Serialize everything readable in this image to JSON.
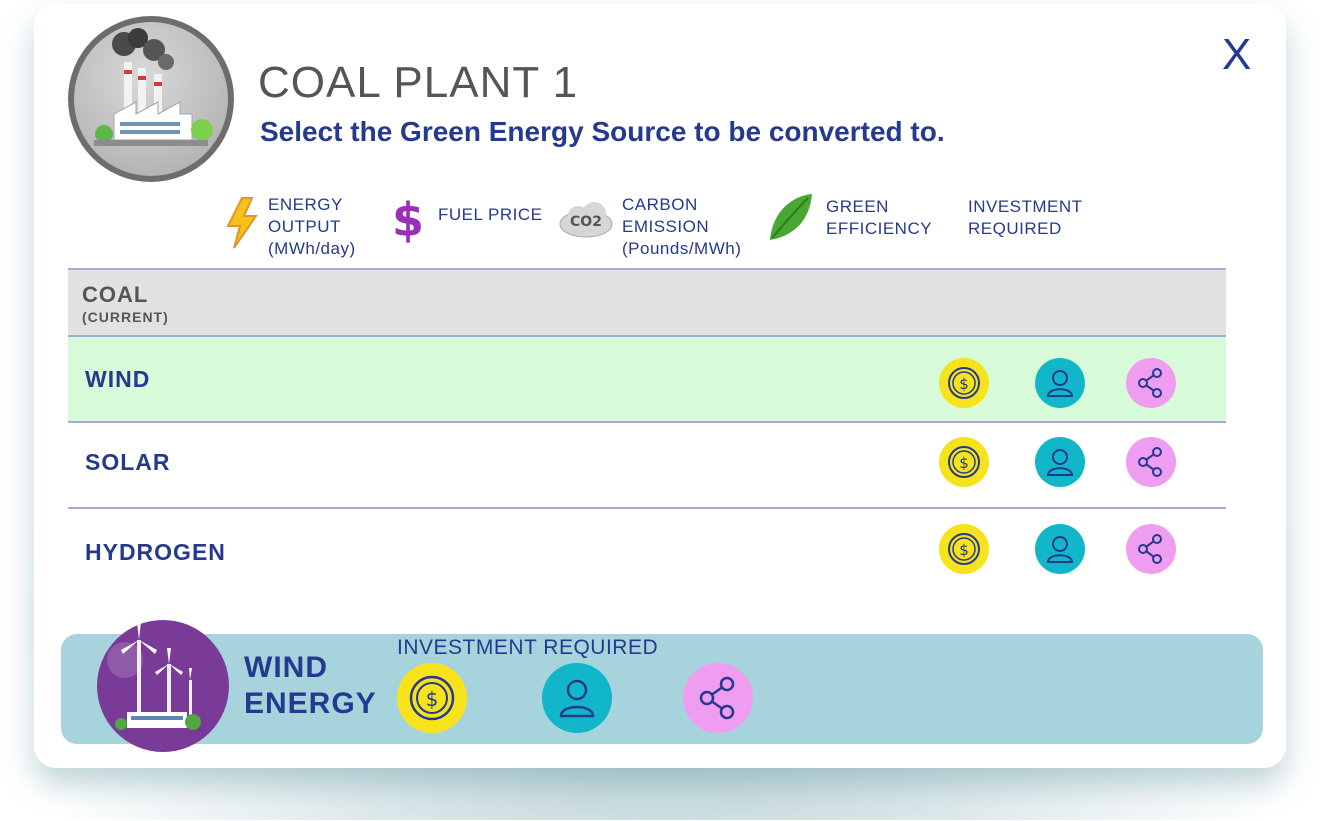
{
  "header": {
    "title": "COAL PLANT 1",
    "subtitle": "Select the Green Energy Source to be converted to.",
    "close_label": "X"
  },
  "legend": {
    "energy_output": {
      "line1": "ENERGY",
      "line2": "OUTPUT",
      "line3": "(MWh/day)",
      "icon": "lightning-icon"
    },
    "fuel_price": {
      "label": "FUEL PRICE",
      "icon": "dollar-icon"
    },
    "carbon_emission": {
      "line1": "CARBON",
      "line2": "EMISSION",
      "line3": "(Pounds/MWh)",
      "icon": "co2-cloud-icon",
      "icon_text": "CO2"
    },
    "green_efficiency": {
      "line1": "GREEN",
      "line2": "EFFICIENCY",
      "icon": "leaf-icon"
    },
    "investment_required": {
      "line1": "INVESTMENT",
      "line2": "REQUIRED"
    }
  },
  "rows": {
    "coal": {
      "label": "COAL",
      "sublabel": "(CURRENT)"
    },
    "wind": {
      "label": "WIND"
    },
    "solar": {
      "label": "SOLAR"
    },
    "hydrogen": {
      "label": "HYDROGEN"
    }
  },
  "selected": {
    "name_line1": "WIND",
    "name_line2": "ENERGY",
    "investment_label": "INVESTMENT REQUIRED"
  },
  "colors": {
    "brand_blue": "#253a8f",
    "coin_yellow": "#f7e31b",
    "person_teal": "#12b6c9",
    "network_pink": "#ef9df0",
    "selected_row": "#d7fbd8",
    "bottom_bar": "#a7d4dc",
    "wind_badge": "#7a3b98"
  }
}
